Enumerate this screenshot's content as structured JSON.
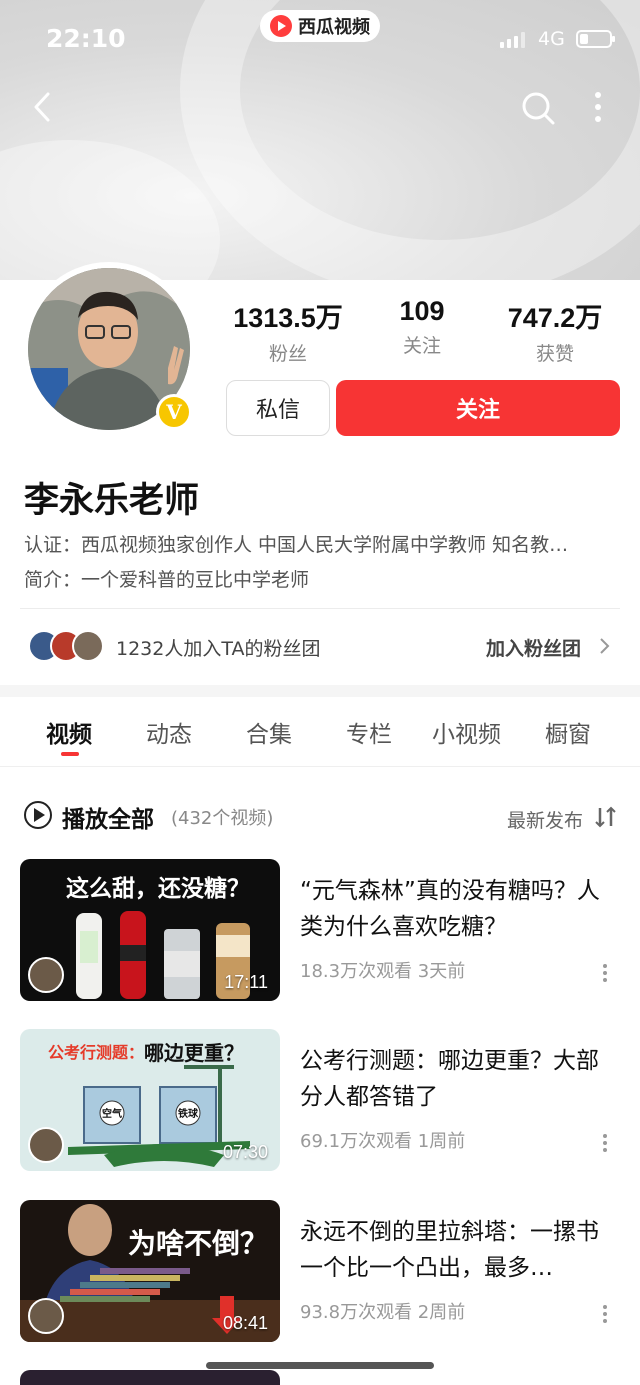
{
  "status_bar": {
    "time": "22:10",
    "app_name": "西瓜视频",
    "network": "4G"
  },
  "nav": {
    "back_icon": "chevron-left-icon",
    "search_icon": "search-icon",
    "more_icon": "more-vertical-icon"
  },
  "profile": {
    "name": "李永乐老师",
    "stats": [
      {
        "value": "1313.5万",
        "label": "粉丝"
      },
      {
        "value": "109",
        "label": "关注"
      },
      {
        "value": "747.2万",
        "label": "获赞"
      }
    ],
    "message_button": "私信",
    "follow_button": "关注",
    "verification": "认证：西瓜视频独家创作人 中国人民大学附属中学教师 知名教…",
    "bio": "简介：一个爱科普的豆比中学老师",
    "badge": "V"
  },
  "fan_group": {
    "text": "1232人加入TA的粉丝团",
    "join_label": "加入粉丝团"
  },
  "tabs": [
    {
      "label": "视频",
      "active": true
    },
    {
      "label": "动态"
    },
    {
      "label": "合集"
    },
    {
      "label": "专栏"
    },
    {
      "label": "小视频"
    },
    {
      "label": "橱窗"
    }
  ],
  "list_header": {
    "play_all": "播放全部",
    "count": "(432个视频)",
    "sort": "最新发布"
  },
  "videos": [
    {
      "title": "“元气森林”真的没有糖吗？人类为什么喜欢吃糖？",
      "meta": "18.3万次观看  3天前",
      "duration": "17:11",
      "overlay": "这么甜，还没糖？"
    },
    {
      "title": "公考行测题：哪边更重？大部分人都答错了",
      "meta": "69.1万次观看  1周前",
      "duration": "07:30",
      "overlay_prefix": "公考行测题：",
      "overlay": "哪边更重？",
      "left_cup": "空气",
      "right_cup": "铁球"
    },
    {
      "title": "永远不倒的里拉斜塔：一摞书一个比一个凸出，最多…",
      "meta": "93.8万次观看  2周前",
      "duration": "08:41",
      "overlay": "为啥不倒？"
    }
  ],
  "colors": {
    "accent": "#f73434",
    "badge": "#f7c600"
  }
}
